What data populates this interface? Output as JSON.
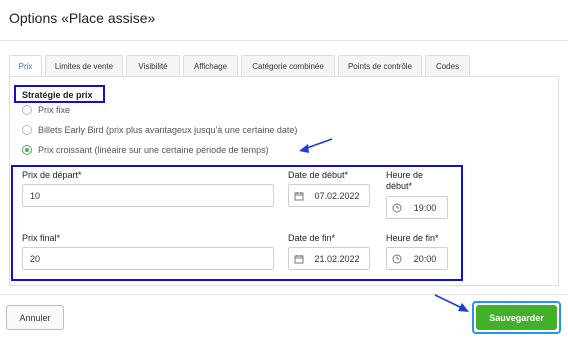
{
  "header": {
    "title": "Options «Place assise»"
  },
  "tabs": [
    {
      "label": "Prix",
      "active": true
    },
    {
      "label": "Limites de vente",
      "active": false
    },
    {
      "label": "Visibilité",
      "active": false
    },
    {
      "label": "Affichage",
      "active": false
    },
    {
      "label": "Catégorie combinée",
      "active": false
    },
    {
      "label": "Points de contrôle",
      "active": false
    },
    {
      "label": "Codes",
      "active": false
    }
  ],
  "pricing": {
    "section_title": "Stratégie de prix",
    "options": [
      {
        "label": "Prix fixe",
        "checked": false
      },
      {
        "label": "Billets Early Bird (prix plus avantageux jusqu'à une certaine date)",
        "checked": false
      },
      {
        "label": "Prix croissant (linéaire sur une certaine période de temps)",
        "checked": true
      }
    ]
  },
  "fields": {
    "start_price": {
      "label": "Prix de départ*",
      "value": "10"
    },
    "start_date": {
      "label": "Date de début*",
      "value": "07.02.2022",
      "icon": "calendar-icon"
    },
    "start_time": {
      "label_line1": "Heure de",
      "label_line2": "début*",
      "value": "19:00",
      "icon": "clock-icon"
    },
    "end_price": {
      "label": "Prix final*",
      "value": "20"
    },
    "end_date": {
      "label": "Date de fin*",
      "value": "21.02.2022",
      "icon": "calendar-icon"
    },
    "end_time": {
      "label": "Heure de fin*",
      "value": "20:00",
      "icon": "clock-icon"
    }
  },
  "footer": {
    "cancel_label": "Annuler",
    "save_label": "Sauvegarder"
  },
  "colors": {
    "highlight": "#1111c8",
    "save_green": "#43b02a",
    "tab_active": "#2a7fc1",
    "arrow": "#1a3fd6"
  }
}
